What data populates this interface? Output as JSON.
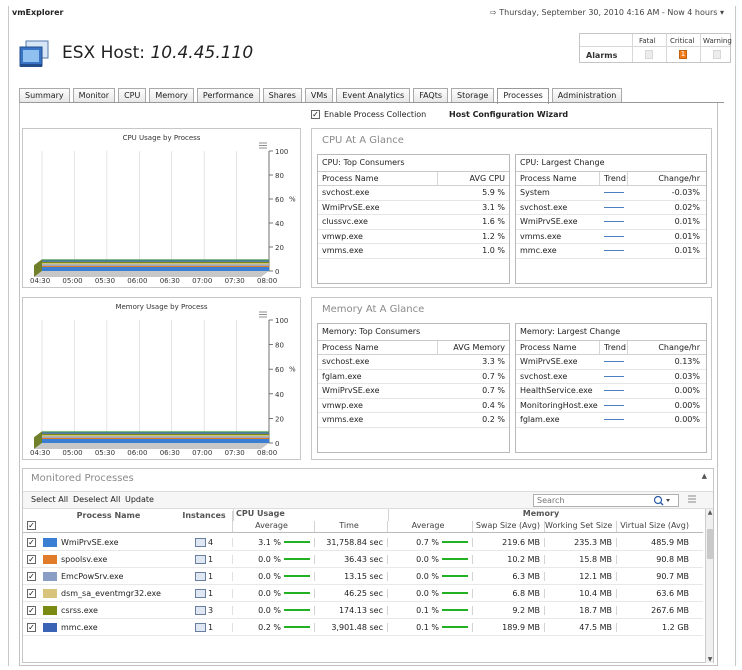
{
  "app": {
    "title": "vmExplorer"
  },
  "header": {
    "date_text": "Thursday, September 30, 2010 4:16 AM - Now 4 hours",
    "host_prefix": "ESX Host:",
    "host_ip": "10.4.45.110"
  },
  "alarms": {
    "label": "Alarms",
    "fatal_label": "Fatal",
    "critical_label": "Critical",
    "warning_label": "Warning",
    "critical_value": "1",
    "critical_color": "#f07c1a"
  },
  "tabs": [
    "Summary",
    "Monitor",
    "CPU",
    "Memory",
    "Performance",
    "Shares",
    "VMs",
    "Event Analytics",
    "FAQts",
    "Storage",
    "Processes",
    "Administration"
  ],
  "active_tab": "Processes",
  "toolbar": {
    "enable_process_label": "Enable Process Collection",
    "enable_process_checked": "✓",
    "wizard_label": "Host Configuration Wizard"
  },
  "charts": {
    "cpu_title": "CPU Usage by Process",
    "mem_title": "Memory Usage by Process",
    "y_ticks": [
      "100",
      "80",
      "60",
      "40",
      "20",
      "0"
    ],
    "y_unit": "%",
    "x_ticks": [
      "04:30",
      "05:00",
      "05:30",
      "06:00",
      "06:30",
      "07:00",
      "07:30",
      "08:00"
    ]
  },
  "chart_data": [
    {
      "type": "area",
      "title": "CPU Usage by Process",
      "ylabel": "%",
      "ylim": [
        0,
        100
      ],
      "x": [
        "04:30",
        "05:00",
        "05:30",
        "06:00",
        "06:30",
        "07:00",
        "07:30",
        "08:00"
      ],
      "legend": "none"
    },
    {
      "type": "area",
      "title": "Memory Usage by Process",
      "ylabel": "%",
      "ylim": [
        0,
        100
      ],
      "x": [
        "04:30",
        "05:00",
        "05:30",
        "06:00",
        "06:30",
        "07:00",
        "07:30",
        "08:00"
      ],
      "legend": "none"
    }
  ],
  "cpu_glance": {
    "title": "CPU At A Glance",
    "top": {
      "title": "CPU: Top Consumers",
      "headers": [
        "Process Name",
        "AVG CPU"
      ],
      "rows": [
        [
          "svchost.exe",
          "5.9 %"
        ],
        [
          "WmiPrvSE.exe",
          "3.1 %"
        ],
        [
          "clussvc.exe",
          "1.6 %"
        ],
        [
          "vmwp.exe",
          "1.2 %"
        ],
        [
          "vmms.exe",
          "1.0 %"
        ]
      ]
    },
    "change": {
      "title": "CPU: Largest Change",
      "headers": [
        "Process Name",
        "Trend",
        "Change/hr"
      ],
      "rows": [
        [
          "System",
          "-0.03%"
        ],
        [
          "svchost.exe",
          "0.02%"
        ],
        [
          "WmiPrvSE.exe",
          "0.01%"
        ],
        [
          "vmms.exe",
          "0.01%"
        ],
        [
          "mmc.exe",
          "0.01%"
        ]
      ]
    }
  },
  "mem_glance": {
    "title": "Memory At A Glance",
    "top": {
      "title": "Memory: Top Consumers",
      "headers": [
        "Process Name",
        "AVG Memory"
      ],
      "rows": [
        [
          "svchost.exe",
          "3.3 %"
        ],
        [
          "fglam.exe",
          "0.7 %"
        ],
        [
          "WmiPrvSE.exe",
          "0.7 %"
        ],
        [
          "vmwp.exe",
          "0.4 %"
        ],
        [
          "vmms.exe",
          "0.2 %"
        ]
      ]
    },
    "change": {
      "title": "Memory: Largest Change",
      "headers": [
        "Process Name",
        "Trend",
        "Change/hr"
      ],
      "rows": [
        [
          "WmiPrvSE.exe",
          "0.13%"
        ],
        [
          "svchost.exe",
          "0.03%"
        ],
        [
          "HealthService.exe",
          "0.00%"
        ],
        [
          "MonitoringHost.exe",
          "0.00%"
        ],
        [
          "fglam.exe",
          "0.00%"
        ]
      ]
    }
  },
  "monitored": {
    "title": "Monitored Processes",
    "select_all": "Select All",
    "deselect_all": "Deselect All",
    "update": "Update",
    "search_placeholder": "Search",
    "headers": {
      "process": "Process Name",
      "instances": "Instances",
      "cpu_group": "CPU Usage",
      "mem_group": "Memory",
      "cpu_avg": "Average",
      "cpu_time": "Time",
      "mem_avg": "Average",
      "swap": "Swap Size (Avg)",
      "ws": "Working Set Size",
      "virt": "Virtual Size (Avg)"
    },
    "rows": [
      {
        "name": "WmiPrvSE.exe",
        "color": "#3b7fd4",
        "inst": "4",
        "cpu_avg": "3.1 %",
        "cpu_time": "31,758.84 sec",
        "mem_avg": "0.7 %",
        "swap": "219.6 MB",
        "ws": "235.3 MB",
        "virt": "485.9 MB"
      },
      {
        "name": "spoolsv.exe",
        "color": "#e07b2a",
        "inst": "1",
        "cpu_avg": "0.0 %",
        "cpu_time": "36.43 sec",
        "mem_avg": "0.0 %",
        "swap": "10.2 MB",
        "ws": "15.8 MB",
        "virt": "90.8 MB"
      },
      {
        "name": "EmcPowSrv.exe",
        "color": "#8a9ec5",
        "inst": "1",
        "cpu_avg": "0.0 %",
        "cpu_time": "13.15 sec",
        "mem_avg": "0.0 %",
        "swap": "6.3 MB",
        "ws": "12.1 MB",
        "virt": "90.7 MB"
      },
      {
        "name": "dsm_sa_eventmgr32.exe",
        "color": "#d7c47a",
        "inst": "1",
        "cpu_avg": "0.0 %",
        "cpu_time": "46.25 sec",
        "mem_avg": "0.0 %",
        "swap": "6.8 MB",
        "ws": "10.4 MB",
        "virt": "63.6 MB"
      },
      {
        "name": "csrss.exe",
        "color": "#7a8a13",
        "inst": "3",
        "cpu_avg": "0.0 %",
        "cpu_time": "174.13 sec",
        "mem_avg": "0.1 %",
        "swap": "9.2 MB",
        "ws": "18.7 MB",
        "virt": "267.6 MB"
      },
      {
        "name": "mmc.exe",
        "color": "#3a62b5",
        "inst": "1",
        "cpu_avg": "0.2 %",
        "cpu_time": "3,901.48 sec",
        "mem_avg": "0.1 %",
        "swap": "189.9 MB",
        "ws": "47.5 MB",
        "virt": "1.2 GB"
      }
    ]
  }
}
